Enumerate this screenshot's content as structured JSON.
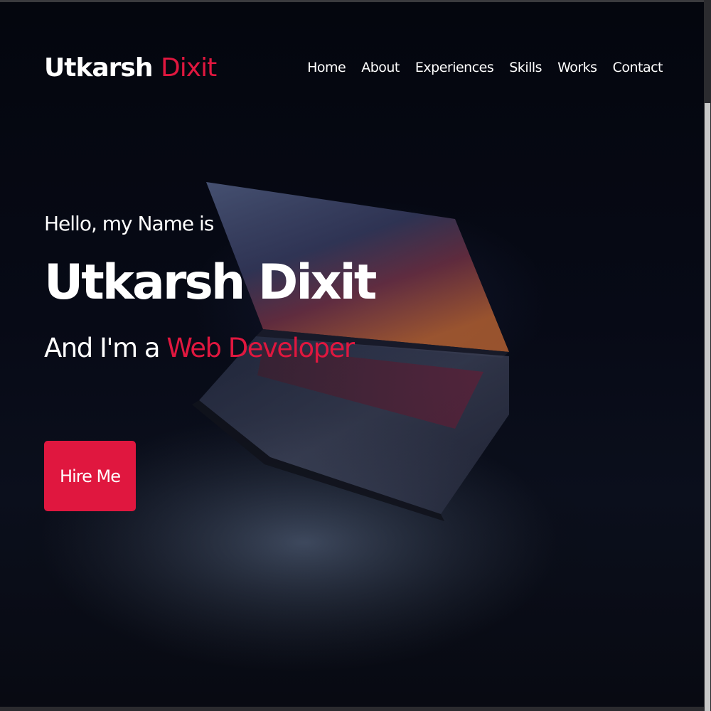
{
  "logo": {
    "first": "Utkarsh",
    "last": "Dixit"
  },
  "nav": {
    "items": [
      {
        "label": "Home"
      },
      {
        "label": "About"
      },
      {
        "label": "Experiences"
      },
      {
        "label": "Skills"
      },
      {
        "label": "Works"
      },
      {
        "label": "Contact"
      }
    ]
  },
  "hero": {
    "greeting": "Hello, my Name is",
    "name": "Utkarsh Dixit",
    "role_prefix": "And I'm a ",
    "role": "Web Developer",
    "cta_label": "Hire Me"
  },
  "colors": {
    "accent": "#e0173f",
    "background": "#05070f",
    "text": "#ffffff"
  }
}
